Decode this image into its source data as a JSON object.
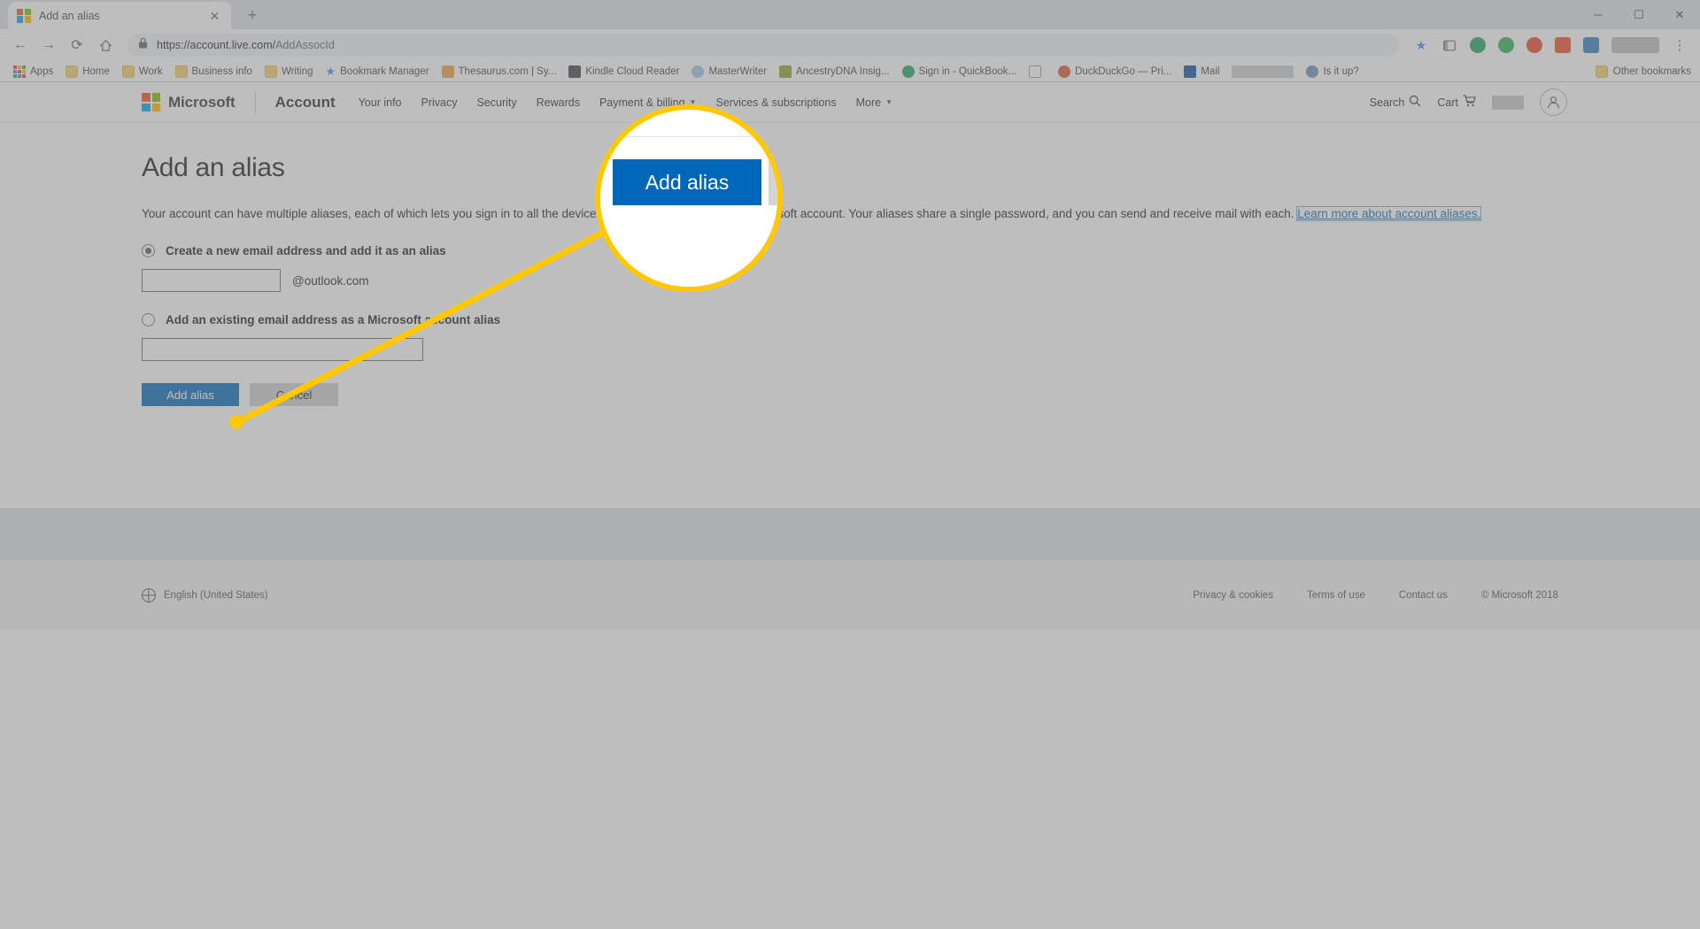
{
  "browser": {
    "tab": {
      "title": "Add an alias",
      "favicon": "microsoft-logo-icon",
      "close_label": "✕"
    },
    "newtab_label": "+",
    "window_controls": {
      "minimize": "─",
      "maximize": "☐",
      "close": "✕"
    },
    "toolbar": {
      "back_label": "←",
      "forward_label": "→",
      "reload_label": "⟳",
      "home_label": "⌂",
      "url": "https://account.live.com/",
      "url_path": "AddAssocId",
      "lock_label": "lock",
      "star_label": "★",
      "menu_label": "⋮"
    },
    "bookmarks": [
      {
        "label": "Apps",
        "icon": "apps-grid-icon"
      },
      {
        "label": "Home",
        "icon": "folder-icon"
      },
      {
        "label": "Work",
        "icon": "folder-icon"
      },
      {
        "label": "Business info",
        "icon": "folder-icon"
      },
      {
        "label": "Writing",
        "icon": "folder-icon"
      },
      {
        "label": "Bookmark Manager",
        "icon": "star-icon"
      },
      {
        "label": "Thesaurus.com | Sy...",
        "icon": "thesaurus-icon"
      },
      {
        "label": "Kindle Cloud Reader",
        "icon": "kindle-icon"
      },
      {
        "label": "MasterWriter",
        "icon": "masterwriter-icon"
      },
      {
        "label": "AncestryDNA Insig...",
        "icon": "ancestry-icon"
      },
      {
        "label": "Sign in - QuickBook...",
        "icon": "quickbooks-icon"
      },
      {
        "label": "",
        "icon": "page-icon"
      },
      {
        "label": "DuckDuckGo — Pri...",
        "icon": "duckduckgo-icon"
      },
      {
        "label": "Mail",
        "icon": "outlook-mail-icon"
      },
      {
        "label": "",
        "icon": "redacted-bookmark"
      },
      {
        "label": "Is it up?",
        "icon": "link-icon"
      }
    ],
    "other_bookmarks": {
      "label": "Other bookmarks",
      "icon": "folder-icon"
    }
  },
  "msnav": {
    "brand": "Microsoft",
    "account_label": "Account",
    "links": [
      {
        "label": "Your info",
        "has_caret": false
      },
      {
        "label": "Privacy",
        "has_caret": false
      },
      {
        "label": "Security",
        "has_caret": false
      },
      {
        "label": "Rewards",
        "has_caret": false
      },
      {
        "label": "Payment & billing",
        "has_caret": true
      },
      {
        "label": "Services & subscriptions",
        "has_caret": false
      },
      {
        "label": "More",
        "has_caret": true
      }
    ],
    "search_label": "Search",
    "search_icon": "magnifier-icon",
    "cart_label": "Cart",
    "cart_icon": "cart-icon",
    "avatar_icon": "user-avatar-icon"
  },
  "main": {
    "title": "Add an alias",
    "intro_before": "Your account can have multiple aliases, each of which lets you sign in to all the devices and services that use your Microsoft account. Your aliases share a single password, and you can send and receive mail with each. ",
    "intro_link": "Learn more about account aliases.",
    "option_create": {
      "label": "Create a new email address and add it as an alias",
      "checked": true,
      "input_value": "",
      "suffix": "@outlook.com"
    },
    "option_existing": {
      "label": "Add an existing email address as a Microsoft account alias",
      "checked": false,
      "input_value": ""
    },
    "submit_label": "Add alias",
    "cancel_label": "Cancel"
  },
  "footer": {
    "language": "English (United States)",
    "globe_icon": "globe-icon",
    "links": [
      "Privacy & cookies",
      "Terms of use",
      "Contact us"
    ],
    "copyright": "© Microsoft 2018"
  },
  "callout": {
    "magnified_button_label": "Add alias",
    "highlight_color": "#ffc800",
    "accent_color": "#0067b8"
  }
}
